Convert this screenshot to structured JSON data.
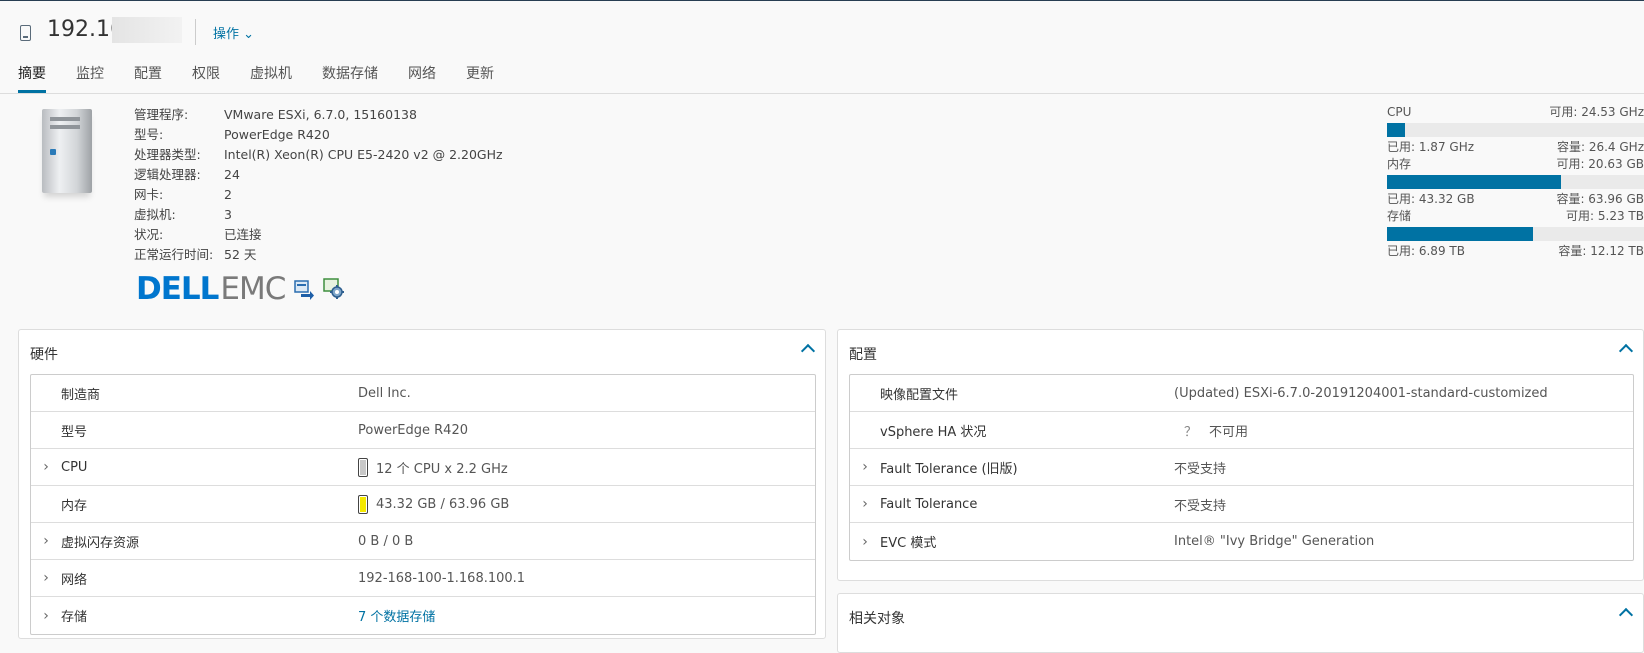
{
  "header": {
    "host_title": "192.16",
    "actions_label": "操作 ⌄"
  },
  "tabs": [
    {
      "label": "摘要",
      "active": true
    },
    {
      "label": "监控"
    },
    {
      "label": "配置"
    },
    {
      "label": "权限"
    },
    {
      "label": "虚拟机"
    },
    {
      "label": "数据存储"
    },
    {
      "label": "网络"
    },
    {
      "label": "更新"
    }
  ],
  "host_info": [
    {
      "key": "管理程序:",
      "value": "VMware ESXi, 6.7.0, 15160138"
    },
    {
      "key": "型号:",
      "value": "PowerEdge R420"
    },
    {
      "key": "处理器类型:",
      "value": "Intel(R) Xeon(R) CPU E5-2420 v2 @ 2.20GHz"
    },
    {
      "key": "逻辑处理器:",
      "value": "24"
    },
    {
      "key": "网卡:",
      "value": "2"
    },
    {
      "key": "虚拟机:",
      "value": "3"
    },
    {
      "key": "状况:",
      "value": "已连接"
    },
    {
      "key": "正常运行时间:",
      "value": "52 天"
    }
  ],
  "logo": {
    "brand": "DELL",
    "suffix": "EMC"
  },
  "resources": [
    {
      "name": "CPU",
      "free": "可用: 24.53 GHz",
      "used": "已用: 1.87 GHz",
      "capacity": "容量: 26.4 GHz",
      "used_fraction": 0.071
    },
    {
      "name": "内存",
      "free": "可用: 20.63 GB",
      "used": "已用: 43.32 GB",
      "capacity": "容量: 63.96 GB",
      "used_fraction": 0.677
    },
    {
      "name": "存储",
      "free": "可用: 5.23 TB",
      "used": "已用: 6.89 TB",
      "capacity": "容量: 12.12 TB",
      "used_fraction": 0.568
    }
  ],
  "hardware": {
    "title": "硬件",
    "rows": [
      {
        "key": "制造商",
        "value": "Dell Inc.",
        "expandable": false
      },
      {
        "key": "型号",
        "value": "PowerEdge R420",
        "expandable": false
      },
      {
        "key": "CPU",
        "value": "12 个 CPU x 2.2 GHz",
        "expandable": true,
        "meter": {
          "fraction": 0.071,
          "color": "#c8c8c8"
        }
      },
      {
        "key": "内存",
        "value": "43.32 GB / 63.96 GB",
        "expandable": false,
        "meter": {
          "fraction": 0.677,
          "color": "#f5e900"
        }
      },
      {
        "key": "虚拟闪存资源",
        "value": "0 B / 0 B",
        "expandable": true
      },
      {
        "key": "网络",
        "value": "192-168-100-1.168.100.1",
        "expandable": true
      },
      {
        "key": "存储",
        "value": "7 个数据存储",
        "expandable": true,
        "link": true
      }
    ]
  },
  "config": {
    "title": "配置",
    "rows": [
      {
        "key": "映像配置文件",
        "value": "(Updated) ESXi-6.7.0-20191204001-standard-customized",
        "expandable": false
      },
      {
        "key": "vSphere HA 状况",
        "value": "不可用",
        "prefix": "？",
        "expandable": false
      },
      {
        "key": "Fault Tolerance (旧版)",
        "value": "不受支持",
        "expandable": true
      },
      {
        "key": "Fault Tolerance",
        "value": "不受支持",
        "expandable": true
      },
      {
        "key": "EVC 模式",
        "value": "Intel® \"Ivy Bridge\" Generation",
        "expandable": true
      }
    ]
  },
  "related": {
    "title": "相关对象"
  },
  "colors": {
    "accent": "#0072a3",
    "topbar": "#283e52"
  }
}
